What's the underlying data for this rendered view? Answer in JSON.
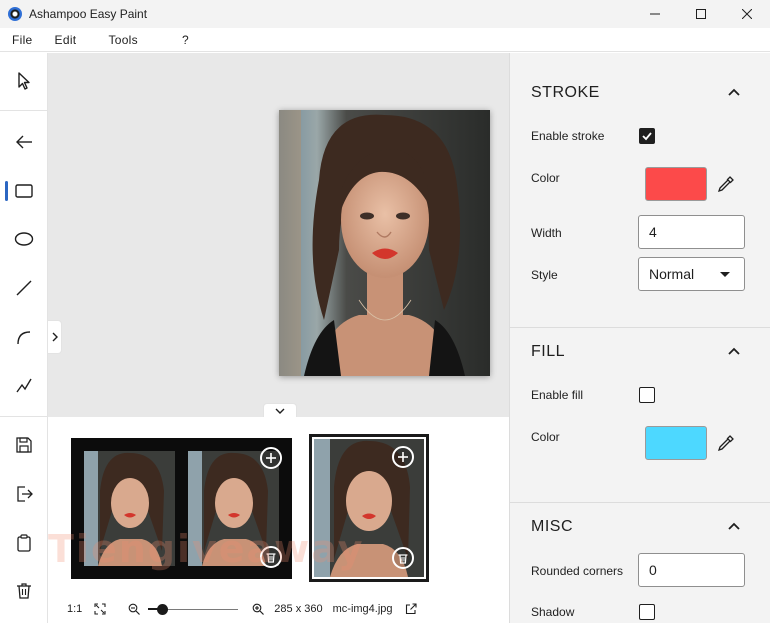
{
  "window": {
    "title": "Ashampoo Easy Paint",
    "controls": {
      "minimize_icon": "minimize-icon",
      "maximize_icon": "maximize-icon",
      "close_icon": "close-icon"
    }
  },
  "menu": {
    "items": [
      {
        "label": "File"
      },
      {
        "label": "Edit"
      },
      {
        "label": "Tools"
      },
      {
        "label": "?"
      }
    ]
  },
  "toolbar": {
    "tools": [
      {
        "name": "select-tool",
        "icon": "pointer-icon"
      },
      {
        "name": "arrow-tool",
        "icon": "arrow-left-icon"
      },
      {
        "name": "rectangle-tool",
        "icon": "rectangle-icon",
        "active": true
      },
      {
        "name": "ellipse-tool",
        "icon": "ellipse-icon"
      },
      {
        "name": "line-tool",
        "icon": "line-icon"
      },
      {
        "name": "curve-tool",
        "icon": "curve-icon"
      },
      {
        "name": "freehand-tool",
        "icon": "freehand-icon"
      },
      {
        "name": "save-tool",
        "icon": "save-icon"
      },
      {
        "name": "export-tool",
        "icon": "export-icon"
      },
      {
        "name": "clipboard-tool",
        "icon": "clipboard-icon"
      },
      {
        "name": "delete-tool",
        "icon": "trash-icon"
      }
    ],
    "accent_color": "#2b66c2"
  },
  "thumbnails": {
    "watermark": "Tiengiveaway",
    "items": [
      {
        "selected": false,
        "photos": 2
      },
      {
        "selected": true,
        "photos": 1
      }
    ]
  },
  "statusbar": {
    "ratio": "1:1",
    "zoom_level": 0.15,
    "dimensions": "285 x 360",
    "filename": "mc-img4.jpg"
  },
  "panel": {
    "stroke": {
      "title": "STROKE",
      "enable_label": "Enable stroke",
      "enabled": true,
      "color_label": "Color",
      "color": "#fc4a4a",
      "width_label": "Width",
      "width_value": "4",
      "style_label": "Style",
      "style_value": "Normal"
    },
    "fill": {
      "title": "FILL",
      "enable_label": "Enable fill",
      "enabled": false,
      "color_label": "Color",
      "color": "#4dd8ff"
    },
    "misc": {
      "title": "MISC",
      "rounded_label": "Rounded corners",
      "rounded_value": "0",
      "shadow_label": "Shadow",
      "shadow_enabled": false
    }
  }
}
